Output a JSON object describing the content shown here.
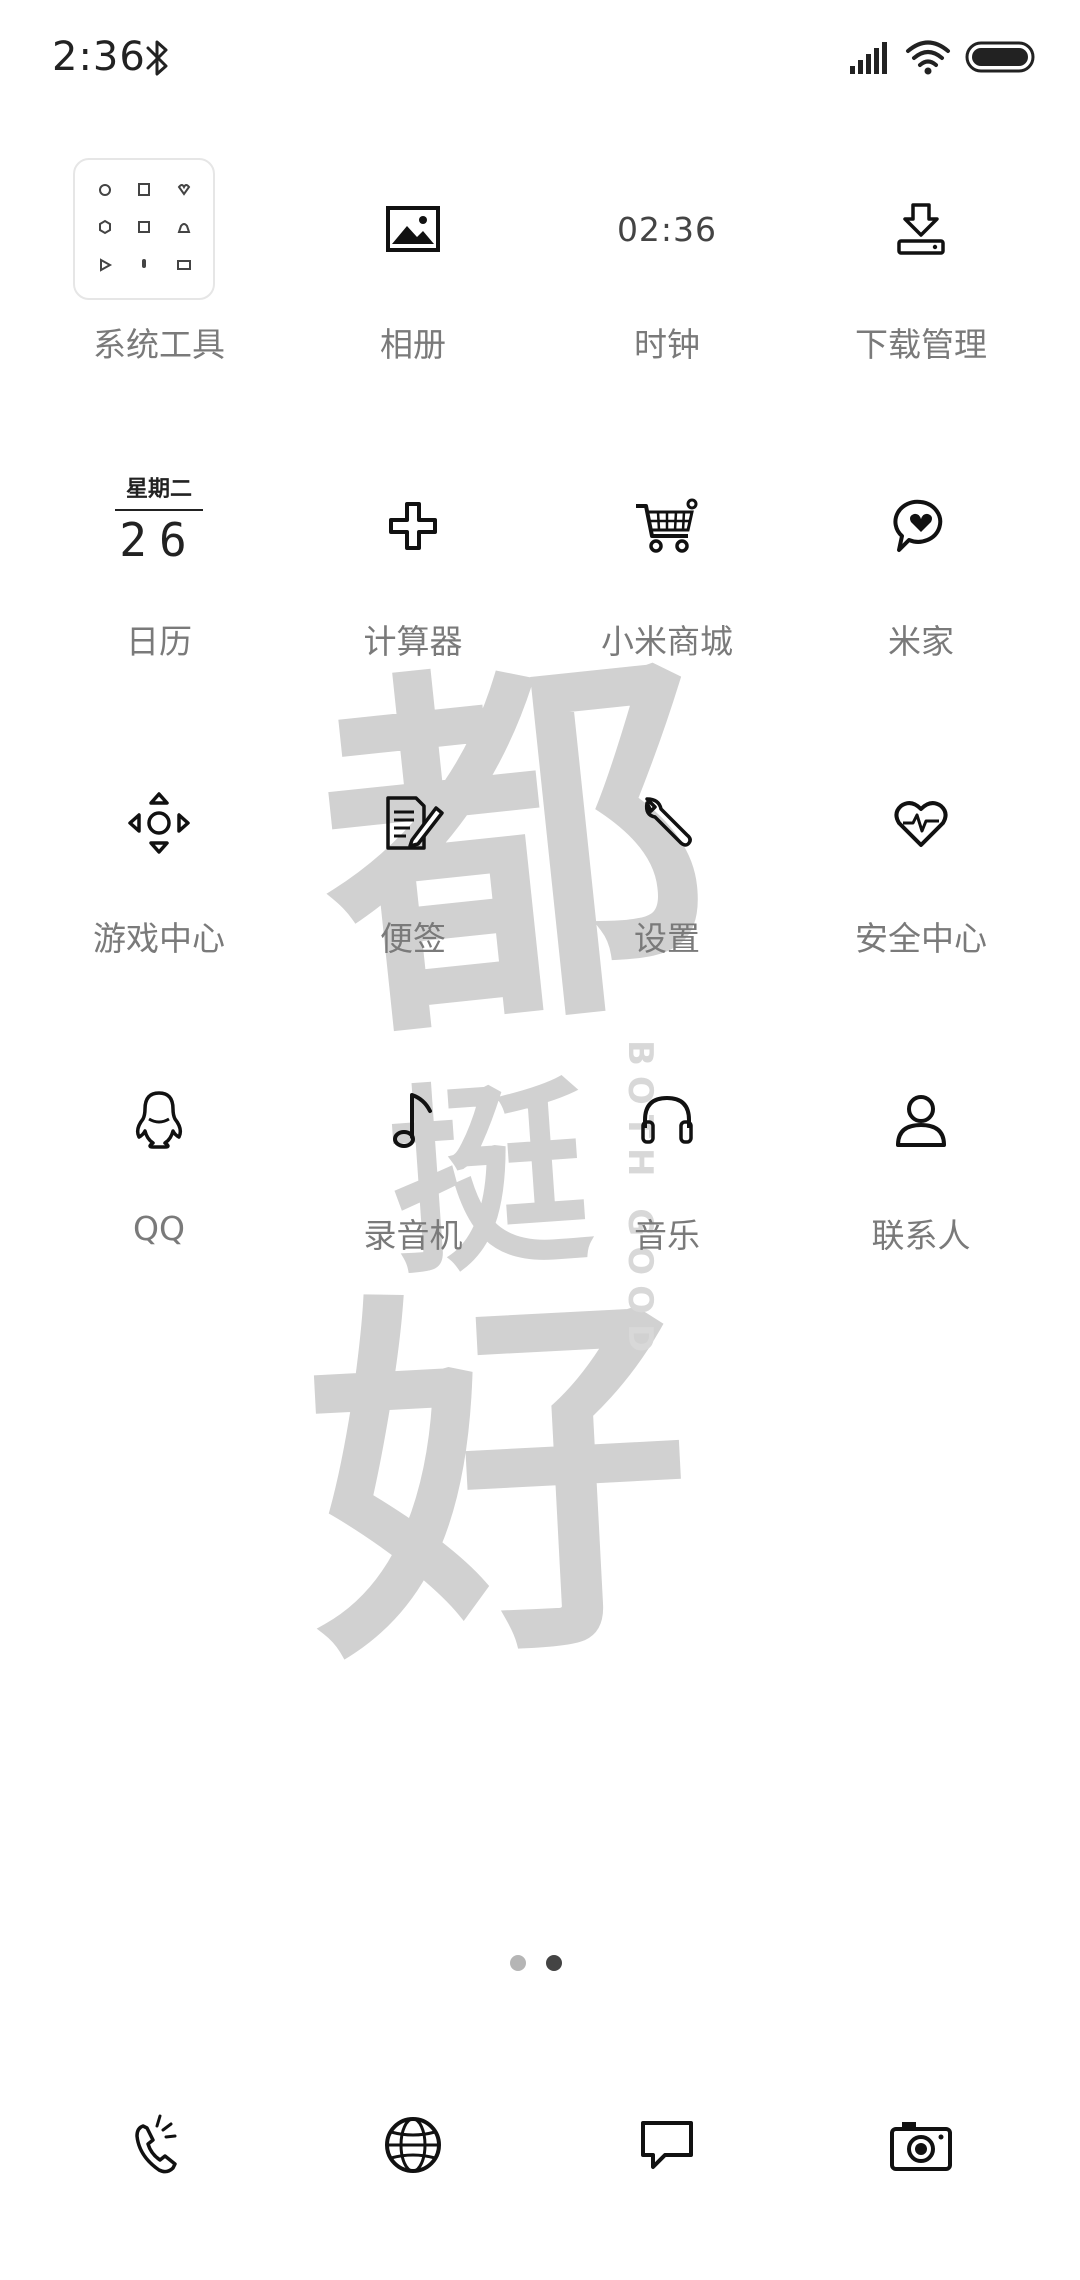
{
  "status_bar": {
    "time": "2:36",
    "icons": [
      "bluetooth-icon",
      "signal-icon",
      "wifi-icon",
      "battery-icon"
    ]
  },
  "wallpaper": {
    "chars": [
      "都",
      "挺",
      "好"
    ],
    "subtitle": "BOTH GOOD"
  },
  "apps": [
    {
      "label": "系统工具",
      "icon": "folder-icon"
    },
    {
      "label": "相册",
      "icon": "gallery-icon"
    },
    {
      "label": "时钟",
      "icon": "clock-widget",
      "clock_text": "02:36"
    },
    {
      "label": "下载管理",
      "icon": "download-icon"
    },
    {
      "label": "日历",
      "icon": "calendar-icon",
      "weekday": "星期二",
      "date": "26"
    },
    {
      "label": "计算器",
      "icon": "calculator-icon"
    },
    {
      "label": "小米商城",
      "icon": "shopping-cart-icon"
    },
    {
      "label": "米家",
      "icon": "mijia-icon"
    },
    {
      "label": "游戏中心",
      "icon": "gamepad-icon"
    },
    {
      "label": "便签",
      "icon": "notes-icon"
    },
    {
      "label": "设置",
      "icon": "wrench-icon"
    },
    {
      "label": "安全中心",
      "icon": "security-heart-icon"
    },
    {
      "label": "QQ",
      "icon": "qq-penguin-icon"
    },
    {
      "label": "录音机",
      "icon": "music-note-icon"
    },
    {
      "label": "音乐",
      "icon": "headphones-icon"
    },
    {
      "label": "联系人",
      "icon": "contact-icon"
    }
  ],
  "page_indicator": {
    "pages": 2,
    "current": 2
  },
  "dock": [
    "phone-icon",
    "browser-icon",
    "messages-icon",
    "camera-icon"
  ],
  "colors": {
    "label": "#7a7a7a",
    "icon": "#111111",
    "watermark": "#c9c9c9"
  }
}
